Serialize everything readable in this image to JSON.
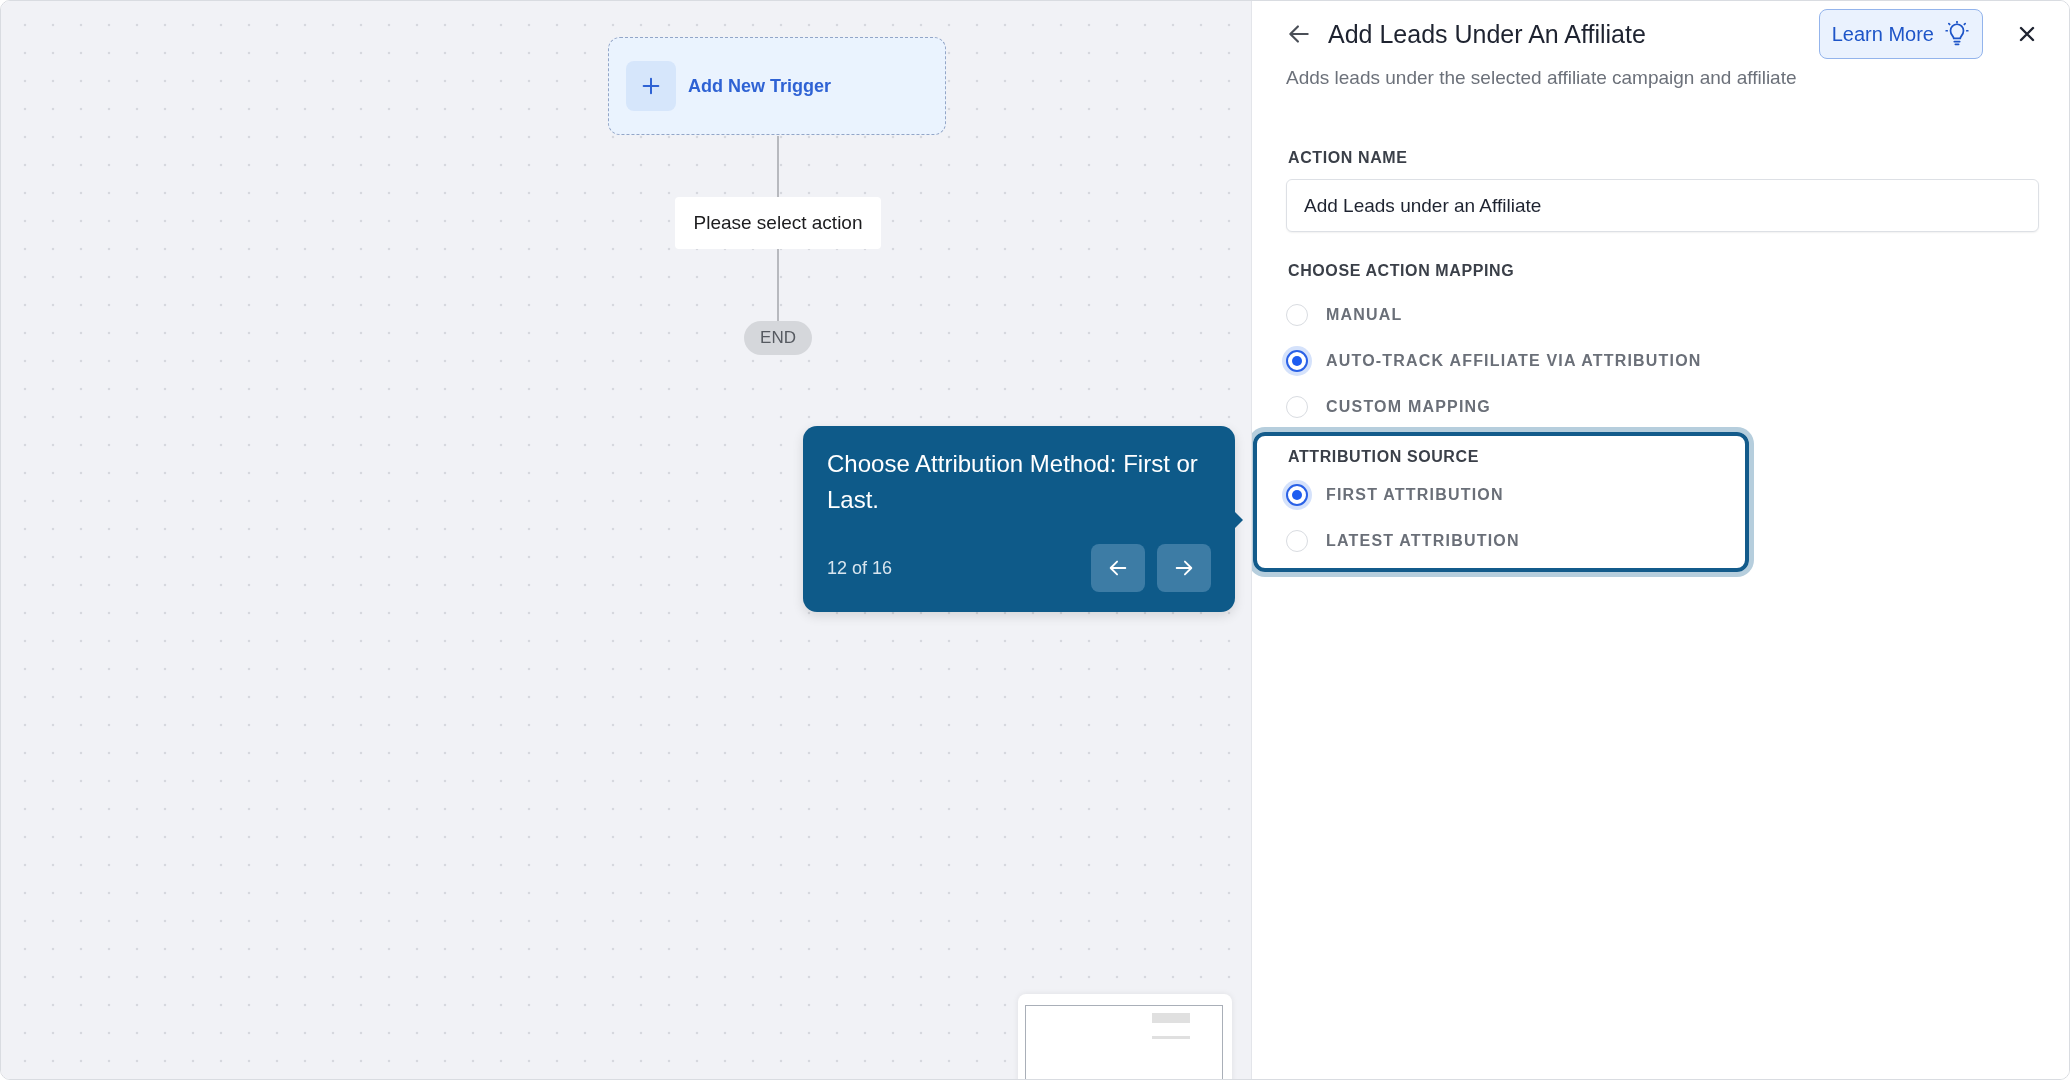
{
  "canvas": {
    "trigger": {
      "label": "Add New Trigger"
    },
    "action_node": {
      "label": "Please select action"
    },
    "end_node": {
      "label": "END"
    }
  },
  "tour_tooltip": {
    "text": "Choose Attribution Method: First or Last.",
    "step": "12 of 16"
  },
  "panel": {
    "title": "Add Leads Under An Affiliate",
    "learn_more": "Learn More",
    "description": "Adds leads under the selected affiliate campaign and affiliate",
    "action_name": {
      "label": "ACTION NAME",
      "value": "Add Leads under an Affiliate"
    },
    "mapping": {
      "label": "CHOOSE ACTION MAPPING",
      "options": [
        {
          "label": "MANUAL",
          "selected": false
        },
        {
          "label": "AUTO-TRACK AFFILIATE VIA ATTRIBUTION",
          "selected": true
        },
        {
          "label": "CUSTOM MAPPING",
          "selected": false
        }
      ]
    },
    "attribution_source": {
      "label": "ATTRIBUTION SOURCE",
      "options": [
        {
          "label": "FIRST ATTRIBUTION",
          "selected": true
        },
        {
          "label": "LATEST ATTRIBUTION",
          "selected": false
        }
      ]
    }
  }
}
